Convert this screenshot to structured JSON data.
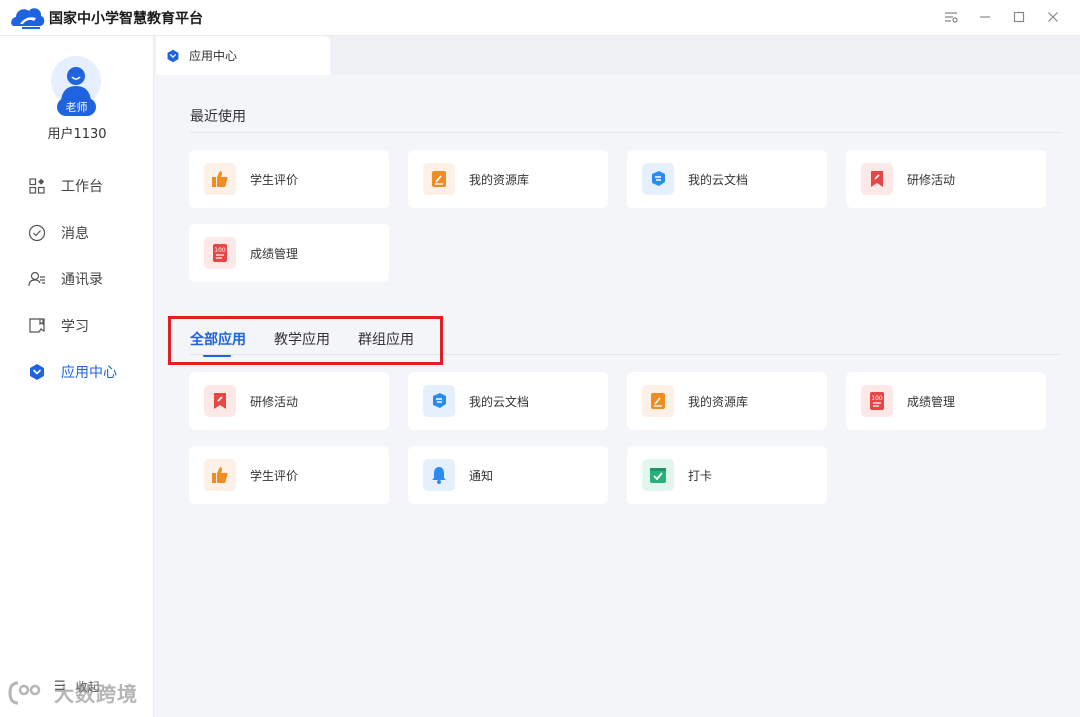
{
  "app": {
    "title": "国家中小学智慧教育平台"
  },
  "user": {
    "role": "老师",
    "name": "用户1130"
  },
  "nav": [
    {
      "label": "工作台",
      "icon": "grid-icon"
    },
    {
      "label": "消息",
      "icon": "message-icon"
    },
    {
      "label": "通讯录",
      "icon": "contacts-icon"
    },
    {
      "label": "学习",
      "icon": "book-icon"
    },
    {
      "label": "应用中心",
      "icon": "app-center-icon",
      "active": true
    }
  ],
  "collapse_label": "收起",
  "watermark": "大数跨境",
  "tab": {
    "label": "应用中心"
  },
  "recent": {
    "title": "最近使用",
    "items": [
      "学生评价",
      "我的资源库",
      "我的云文档",
      "研修活动",
      "成绩管理"
    ]
  },
  "categories": [
    "全部应用",
    "教学应用",
    "群组应用"
  ],
  "all_apps": [
    "研修活动",
    "我的云文档",
    "我的资源库",
    "成绩管理",
    "学生评价",
    "通知",
    "打卡"
  ],
  "colors": {
    "accent": "#1f63e0",
    "highlight": "#e02020"
  }
}
